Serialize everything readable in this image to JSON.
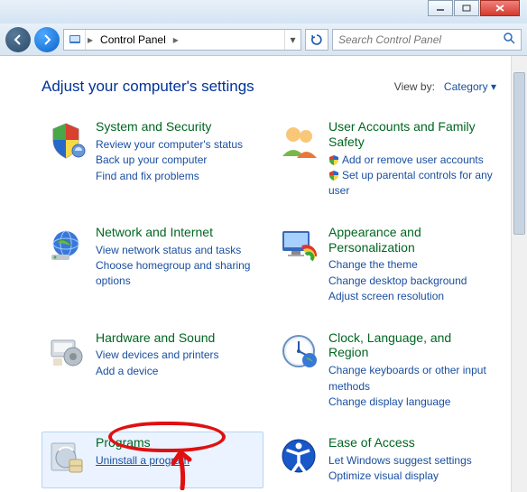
{
  "breadcrumb": {
    "location": "Control Panel"
  },
  "search": {
    "placeholder": "Search Control Panel"
  },
  "header": {
    "title": "Adjust your computer's settings",
    "viewby_label": "View by:",
    "viewby_value": "Category"
  },
  "categories": [
    {
      "id": "system-security",
      "title": "System and Security",
      "links": [
        {
          "text": "Review your computer's status"
        },
        {
          "text": "Back up your computer"
        },
        {
          "text": "Find and fix problems"
        }
      ]
    },
    {
      "id": "user-accounts",
      "title": "User Accounts and Family Safety",
      "links": [
        {
          "text": "Add or remove user accounts",
          "shield": true
        },
        {
          "text": "Set up parental controls for any user",
          "shield": true
        }
      ]
    },
    {
      "id": "network-internet",
      "title": "Network and Internet",
      "links": [
        {
          "text": "View network status and tasks"
        },
        {
          "text": "Choose homegroup and sharing options"
        }
      ]
    },
    {
      "id": "appearance",
      "title": "Appearance and Personalization",
      "links": [
        {
          "text": "Change the theme"
        },
        {
          "text": "Change desktop background"
        },
        {
          "text": "Adjust screen resolution"
        }
      ]
    },
    {
      "id": "hardware-sound",
      "title": "Hardware and Sound",
      "links": [
        {
          "text": "View devices and printers"
        },
        {
          "text": "Add a device"
        }
      ]
    },
    {
      "id": "clock-region",
      "title": "Clock, Language, and Region",
      "links": [
        {
          "text": "Change keyboards or other input methods"
        },
        {
          "text": "Change display language"
        }
      ]
    },
    {
      "id": "programs",
      "title": "Programs",
      "highlight": true,
      "links": [
        {
          "text": "Uninstall a program",
          "underline": true
        }
      ]
    },
    {
      "id": "ease-of-access",
      "title": "Ease of Access",
      "links": [
        {
          "text": "Let Windows suggest settings"
        },
        {
          "text": "Optimize visual display"
        }
      ]
    }
  ]
}
